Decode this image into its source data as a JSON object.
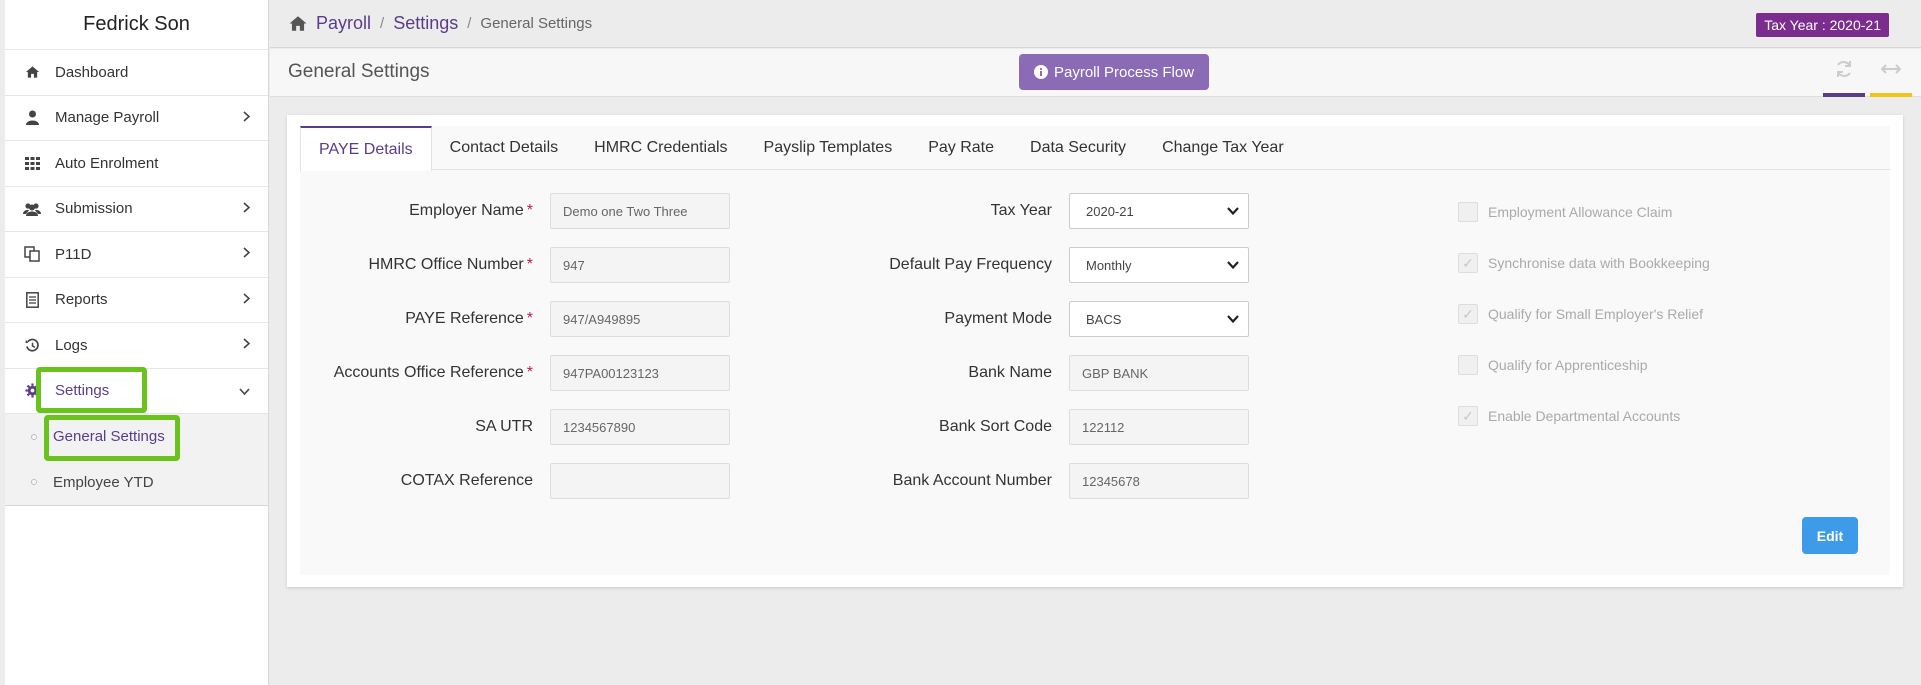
{
  "sidebar": {
    "user_name": "Fedrick Son",
    "items": [
      {
        "label": "Dashboard",
        "icon": "home-icon"
      },
      {
        "label": "Manage Payroll",
        "icon": "user-icon"
      },
      {
        "label": "Auto Enrolment",
        "icon": "grid-icon"
      },
      {
        "label": "Submission",
        "icon": "users-icon"
      },
      {
        "label": "P11D",
        "icon": "copy-icon"
      },
      {
        "label": "Reports",
        "icon": "report-icon"
      },
      {
        "label": "Logs",
        "icon": "history-icon"
      },
      {
        "label": "Settings",
        "icon": "gear-icon"
      }
    ],
    "settings_sub": [
      {
        "label": "General Settings"
      },
      {
        "label": "Employee YTD"
      }
    ]
  },
  "breadcrumb": {
    "payroll": "Payroll",
    "settings": "Settings",
    "current": "General Settings",
    "sep": "/"
  },
  "tax_year_badge": "Tax Year : 2020-21",
  "page_title": "General Settings",
  "process_flow_label": "Payroll Process Flow",
  "tabs": [
    {
      "label": "PAYE Details"
    },
    {
      "label": "Contact Details"
    },
    {
      "label": "HMRC Credentials"
    },
    {
      "label": "Payslip Templates"
    },
    {
      "label": "Pay Rate"
    },
    {
      "label": "Data Security"
    },
    {
      "label": "Change Tax Year"
    }
  ],
  "left_fields": [
    {
      "label": "Employer Name",
      "value": "Demo one Two Three",
      "required": "*"
    },
    {
      "label": "HMRC Office Number",
      "value": "947",
      "required": "*"
    },
    {
      "label": "PAYE Reference",
      "value": "947/A949895",
      "required": "*"
    },
    {
      "label": "Accounts Office Reference",
      "value": "947PA00123123",
      "required": "*"
    },
    {
      "label": "SA UTR",
      "value": "1234567890"
    },
    {
      "label": "COTAX Reference",
      "value": ""
    }
  ],
  "middle_fields": [
    {
      "label": "Tax Year",
      "value": "2020-21",
      "type": "select"
    },
    {
      "label": "Default Pay Frequency",
      "value": "Monthly",
      "type": "select"
    },
    {
      "label": "Payment Mode",
      "value": "BACS",
      "type": "select"
    },
    {
      "label": "Bank Name",
      "value": "GBP BANK"
    },
    {
      "label": "Bank Sort Code",
      "value": "122112"
    },
    {
      "label": "Bank Account Number",
      "value": "12345678"
    }
  ],
  "checkboxes": [
    {
      "label": "Employment Allowance Claim",
      "checked": false
    },
    {
      "label": "Synchronise data with Bookkeeping",
      "checked": true
    },
    {
      "label": "Qualify for Small Employer's Relief",
      "checked": true
    },
    {
      "label": "Qualify for Apprenticeship",
      "checked": false
    },
    {
      "label": "Enable Departmental Accounts",
      "checked": true
    }
  ],
  "edit_label": "Edit",
  "check_mark": "✓",
  "colors": {
    "accent": "#5a3d8a",
    "badge": "#7b2d8e",
    "highlight": "#6ac21c",
    "edit": "#3d9be9",
    "flow_button": "#8b6bb6"
  }
}
